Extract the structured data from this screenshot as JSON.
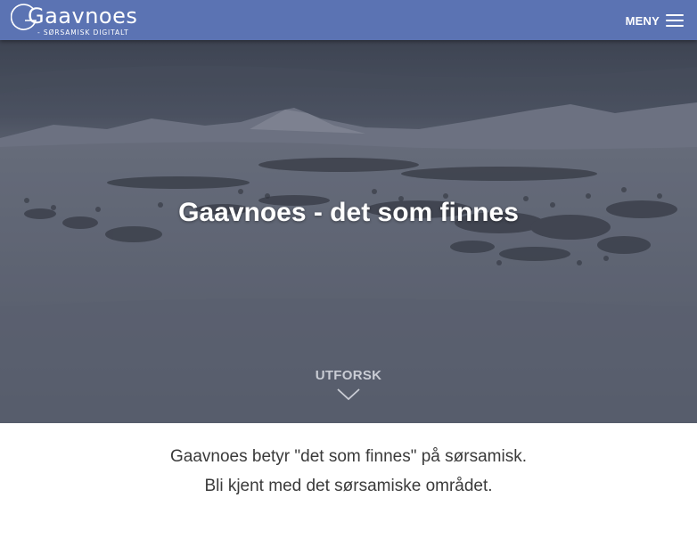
{
  "header": {
    "logo_word": "Gaavnoes",
    "logo_tagline": "- SØRSAMISK DIGITALT",
    "menu_label": "MENY",
    "menu_icon": "hamburger-icon",
    "colors": {
      "bar": "#5b73b3",
      "text": "#ffffff"
    }
  },
  "hero": {
    "title": "Gaavnoes - det som finnes",
    "explore_label": "UTFORSK",
    "explore_icon": "chevron-down-icon"
  },
  "intro": {
    "line1": "Gaavnoes betyr \"det som finnes\" på sørsamisk.",
    "line2": "Bli kjent med det sørsamiske området."
  }
}
